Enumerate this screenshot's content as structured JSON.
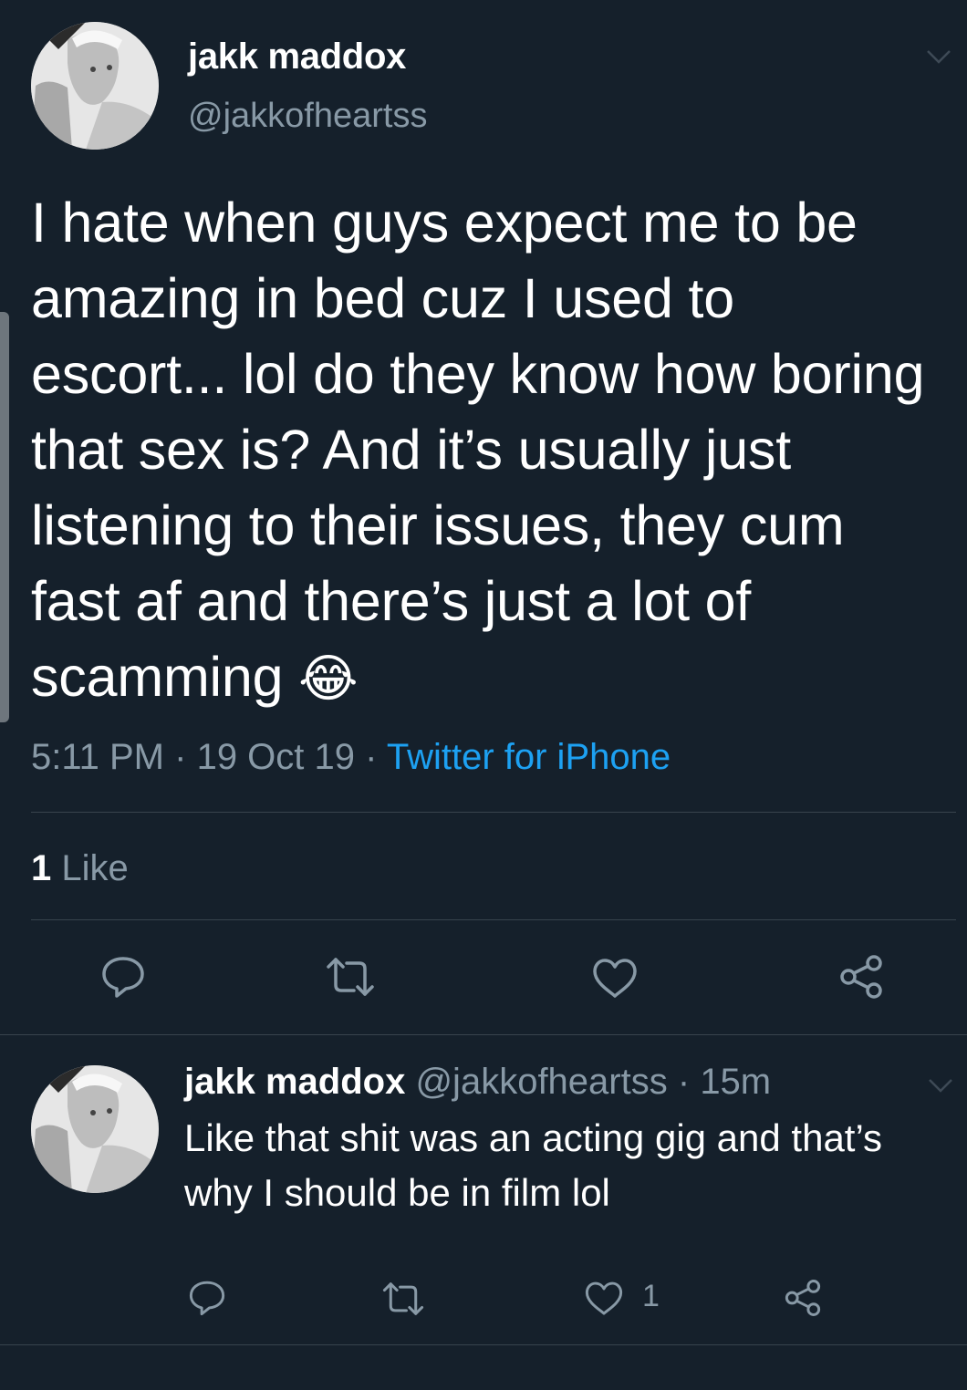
{
  "main_tweet": {
    "display_name": "jakk maddox",
    "handle": "@jakkofheartss",
    "text": "I hate when guys expect me to be amazing in bed cuz I used to escort... lol do they know how boring that sex is? And it’s usually just listening to their issues, they cum fast af and there’s just a lot of scamming",
    "emoji": "😂",
    "time": "5:11 PM",
    "date": "19 Oct 19",
    "separator": "·",
    "source": "Twitter for iPhone",
    "like_count": "1",
    "like_label": "Like"
  },
  "reply_tweet": {
    "display_name": "jakk maddox",
    "handle": "@jakkofheartss",
    "separator": "·",
    "age": "15m",
    "text": "Like that shit was an acting gig and that’s why I should be in film lol",
    "like_count": "1"
  },
  "icons": {
    "reply": "reply-icon",
    "retweet": "retweet-icon",
    "like": "heart-icon",
    "share": "share-icon",
    "menu": "chevron-down-icon"
  },
  "colors": {
    "background": "#15202b",
    "text": "#ffffff",
    "secondary": "#8899a6",
    "link": "#1da1f2",
    "divider": "#38444d"
  }
}
